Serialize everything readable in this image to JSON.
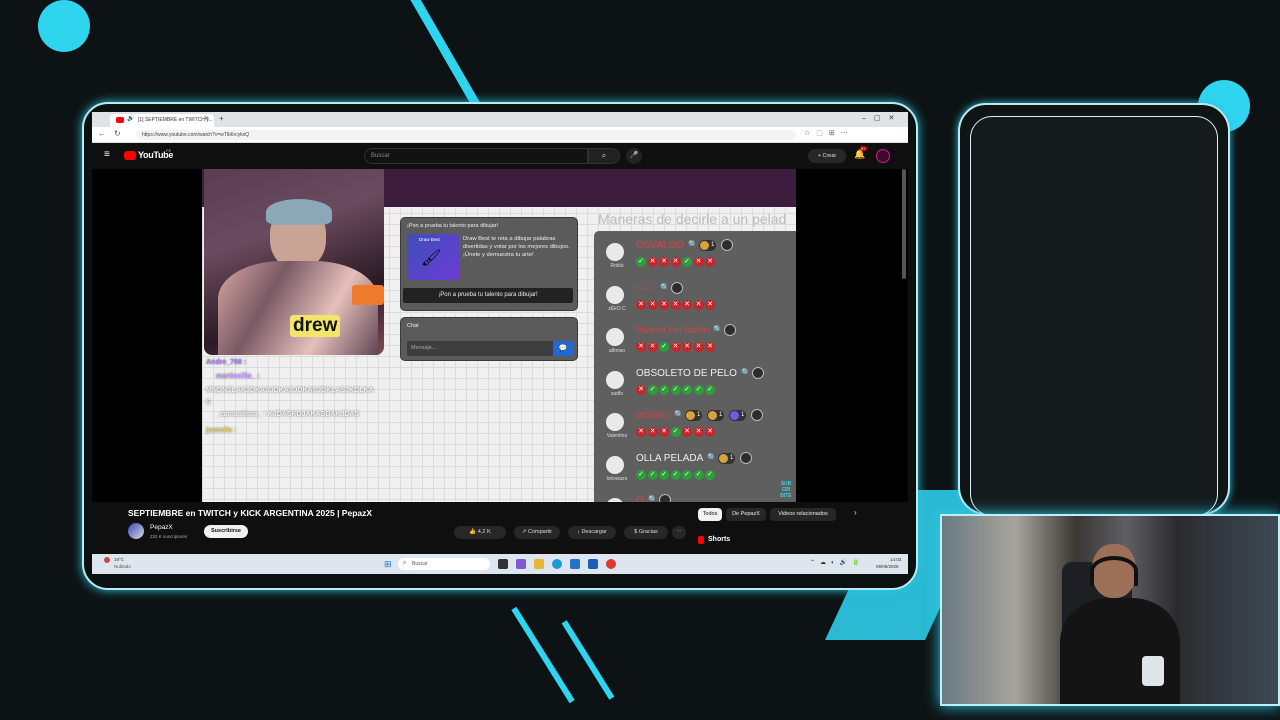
{
  "browser": {
    "tab_title": "[1] SEPTIEMBRE en TWITCH y...",
    "url": "https://www.youtube.com/watch?v=wTlb6rcyksQ"
  },
  "youtube": {
    "logo": "YouTube",
    "logo_sup": "PE",
    "search_placeholder": "Buscar",
    "create_label": "Crear",
    "notif_count": "9+"
  },
  "stream": {
    "promo_title": "¡Pon a prueba tu talento para dibujar!",
    "promo_text": "Draw Best te reta a dibujar palabras divertidas y votar por los mejores dibujos. ¡Únete y demuestra tu arte!",
    "promo_thumb": "Draw Best",
    "promo_button": "¡Pon a prueba tu talento para dibujar!",
    "chat_title": "Chat",
    "chat_placeholder": "Mensaje...",
    "heading": "Maneras de decirle a un pelad",
    "overlay_name": "drew",
    "chat_lines": [
      "Andre_798 :",
      "martincillo_ : ",
      "MNDNSLAKJDKASJDKASJDKASJDKLASJKDLKA",
      "S",
      "_camaulissa_ : KJDASKDJAKASDAKJDAS",
      "juanzilo :"
    ],
    "players": [
      {
        "answer": "OSVALDO",
        "user": "Roblu",
        "answer_color": "#d9423f",
        "marks": [
          "g",
          "r",
          "r",
          "r",
          "g",
          "r",
          "r"
        ],
        "badges": [
          "1"
        ]
      },
      {
        "answer": "------",
        "user": "zEkO C",
        "answer_color": "#d9423f",
        "marks": [
          "r",
          "r",
          "r",
          "r",
          "r",
          "r",
          "r"
        ],
        "badges": []
      },
      {
        "answer": "osama bin laden",
        "user": "alfonso",
        "answer_color": "#d9423f",
        "marks": [
          "r",
          "r",
          "g",
          "r",
          "r",
          "r",
          "r"
        ],
        "badges": []
      },
      {
        "answer": "OBSOLETO DE PELO",
        "user": "sadfo",
        "answer_color": "#eeeeee",
        "marks": [
          "r",
          "g",
          "g",
          "g",
          "g",
          "g",
          "g"
        ],
        "badges": []
      },
      {
        "answer": "ozzuelo",
        "user": "Valentino",
        "answer_color": "#d9423f",
        "marks": [
          "r",
          "r",
          "r",
          "g",
          "r",
          "r",
          "r"
        ],
        "badges": [
          "1",
          "1",
          "1"
        ]
      },
      {
        "answer": "OLLA PELADA",
        "user": "lokowazo",
        "answer_color": "#eeeeee",
        "marks": [
          "g",
          "g",
          "g",
          "g",
          "g",
          "g",
          "g"
        ],
        "badges": [
          "1"
        ]
      },
      {
        "answer": "O",
        "user": "",
        "answer_color": "#d9423f",
        "marks": [],
        "badges": []
      }
    ],
    "corner_logo": "SUB CRI BITE"
  },
  "video": {
    "title": "SEPTIEMBRE en TWITCH y KICK ARGENTINA 2025 | PepazX",
    "channel": "PepazX",
    "subscribers": "232 K suscriptores",
    "subscribe": "Suscribirse",
    "likes": "4,2 K",
    "share": "Compartir",
    "download": "Descargar",
    "thanks": "Gracias",
    "chips": [
      "Todos",
      "De PepazX",
      "Videos relacionados"
    ],
    "shorts": "Shorts"
  },
  "taskbar": {
    "weather_temp": "19°C",
    "weather_desc": "Nublado",
    "search": "Buscar",
    "time": "14:03",
    "date": "09/09/2025"
  }
}
